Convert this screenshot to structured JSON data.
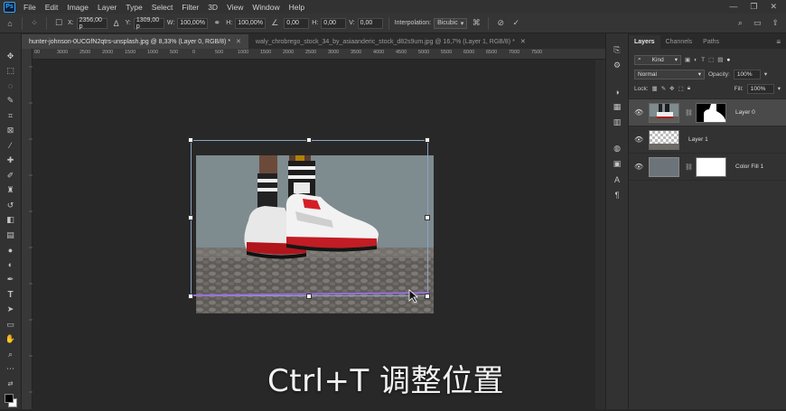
{
  "menu": {
    "logo": "Ps",
    "items": [
      "File",
      "Edit",
      "Image",
      "Layer",
      "Type",
      "Select",
      "Filter",
      "3D",
      "View",
      "Window",
      "Help"
    ]
  },
  "options": {
    "x_label": "X:",
    "x_value": "2356,00 p",
    "y_label": "Y:",
    "y_value": "1309,00 p",
    "w_label": "W:",
    "w_value": "100,00%",
    "h_label": "H:",
    "h_value": "100,00%",
    "angle_value": "0,00",
    "hskew_label": "H:",
    "hskew_value": "0,00",
    "vskew_label": "V:",
    "vskew_value": "0,00",
    "interpolation_label": "Interpolation:",
    "interpolation_value": "Bicubic"
  },
  "tabs": [
    {
      "label": "hunter-johnson-0UCGfN2qtrs-unsplash.jpg @ 8,33% (Layer 0, RGB/8) *",
      "active": true
    },
    {
      "label": "waly_chrobrego_stock_34_by_asiaanderic_stock_d82s9um.jpg @ 16,7% (Layer 1, RGB/8) *",
      "active": false
    }
  ],
  "ruler_ticks": [
    "00",
    "3000",
    "2500",
    "2000",
    "1500",
    "1000",
    "500",
    "0",
    "500",
    "1000",
    "1500",
    "2000",
    "2500",
    "3000",
    "3500",
    "4000",
    "4500",
    "5000",
    "5500",
    "6000",
    "6500",
    "7000",
    "7500"
  ],
  "caption": "Ctrl+T 调整位置",
  "layers_panel": {
    "tabs": [
      "Layers",
      "Channels",
      "Paths"
    ],
    "kind_label": "Kind",
    "blend_mode": "Normal",
    "opacity_label": "Opacity:",
    "opacity_value": "100%",
    "lock_label": "Lock:",
    "fill_label": "Fill:",
    "fill_value": "100%",
    "layers": [
      {
        "name": "Layer 0",
        "selected": true
      },
      {
        "name": "Layer 1",
        "selected": false
      },
      {
        "name": "Color Fill 1",
        "selected": false
      }
    ]
  },
  "colors": {
    "accent": "#31a8ff",
    "canvas_bg": "#282828",
    "panel_bg": "#323232",
    "transform_border": "#8aa3c8",
    "sky": "#7e8b8f"
  },
  "icons": {
    "tools": [
      "move-icon",
      "marquee-icon",
      "lasso-icon",
      "quick-select-icon",
      "crop-icon",
      "frame-icon",
      "eyedropper-icon",
      "healing-icon",
      "brush-icon",
      "stamp-icon",
      "history-brush-icon",
      "eraser-icon",
      "gradient-icon",
      "blur-icon",
      "dodge-icon",
      "pen-icon",
      "type-icon",
      "path-select-icon",
      "shape-icon",
      "hand-icon",
      "zoom-icon",
      "more-icon"
    ]
  }
}
